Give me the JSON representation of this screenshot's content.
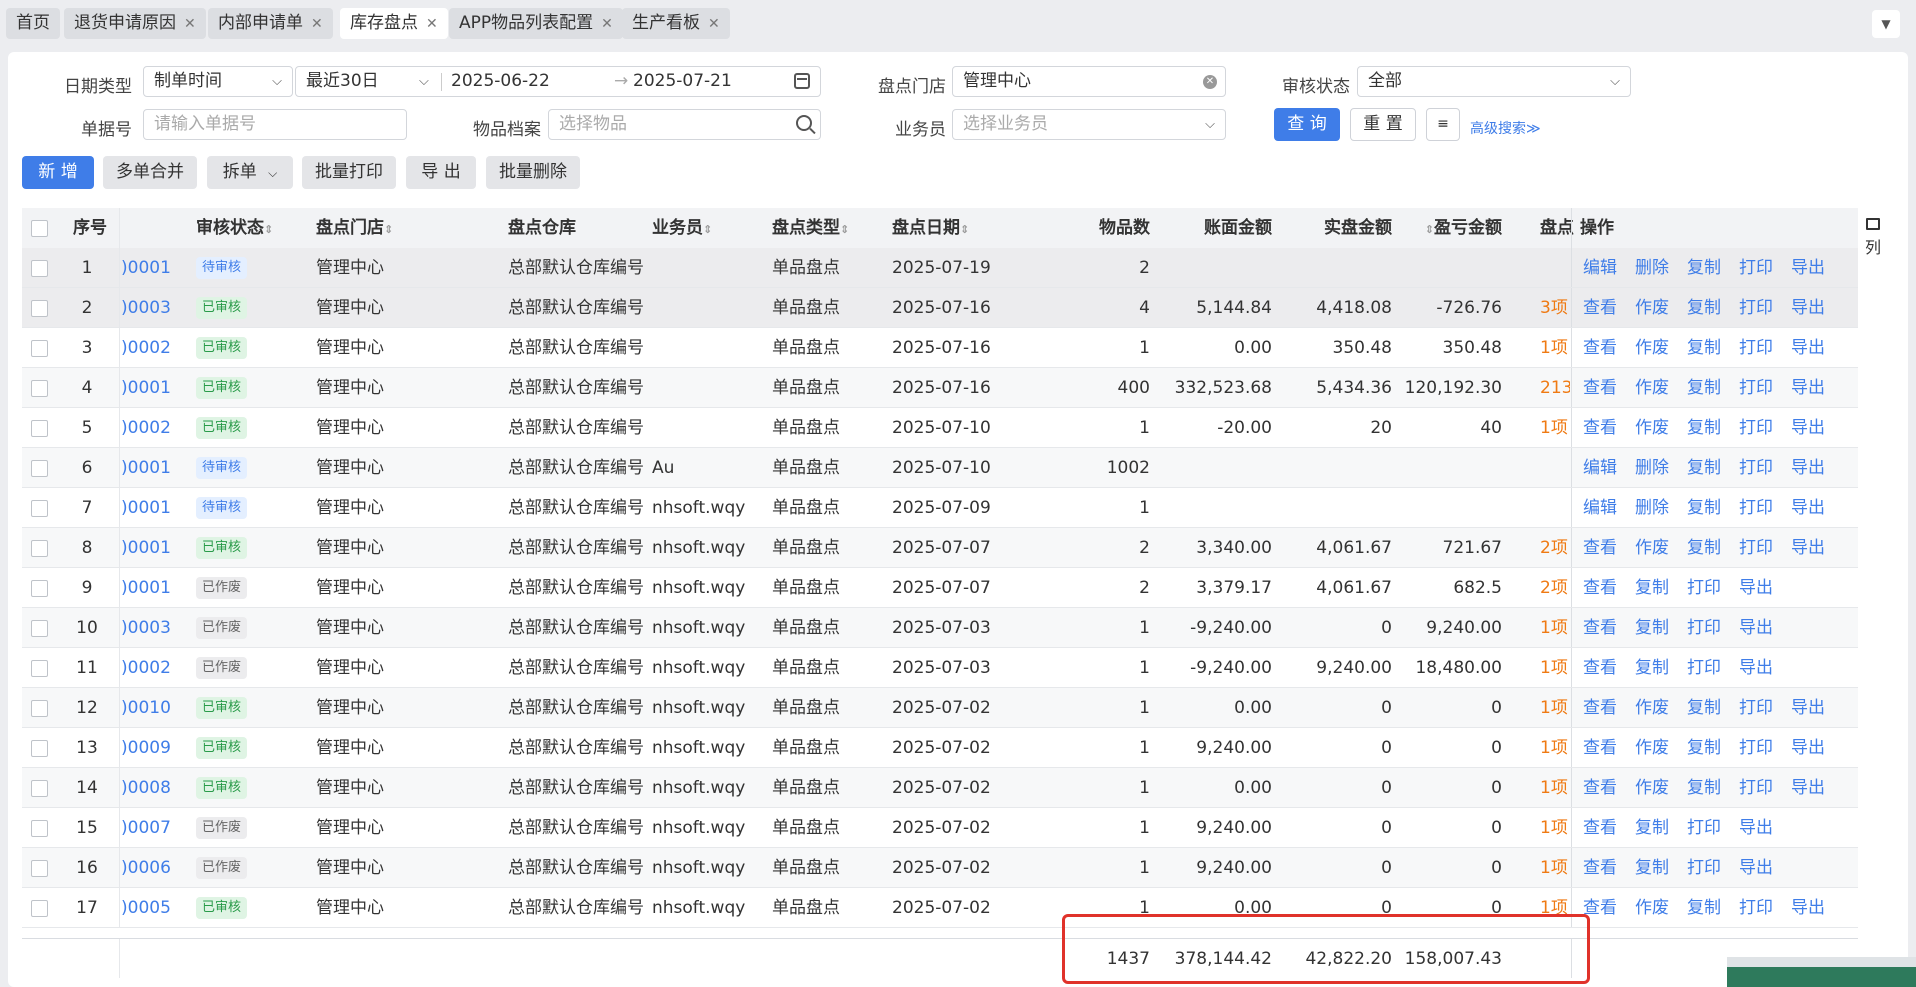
{
  "tabs": [
    {
      "label": "首页",
      "closable": false,
      "active": false
    },
    {
      "label": "退货申请原因",
      "closable": true,
      "active": false
    },
    {
      "label": "内部申请单",
      "closable": true,
      "active": false
    },
    {
      "label": "库存盘点",
      "closable": true,
      "active": true
    },
    {
      "label": "APP物品列表配置",
      "closable": true,
      "active": false
    },
    {
      "label": "生产看板",
      "closable": true,
      "active": false
    }
  ],
  "filters": {
    "date_type_label": "日期类型",
    "date_type_value": "制单时间",
    "date_range_preset": "最近30日",
    "date_start": "2025-06-22",
    "date_arrow": "→",
    "date_end": "2025-07-21",
    "store_label": "盘点门店",
    "store_value": "管理中心",
    "audit_label": "审核状态",
    "audit_value": "全部",
    "doc_no_label": "单据号",
    "doc_no_placeholder": "请输入单据号",
    "item_label": "物品档案",
    "item_placeholder": "选择物品",
    "salesman_label": "业务员",
    "salesman_placeholder": "选择业务员",
    "query": "查 询",
    "reset": "重 置",
    "advanced": "高级搜索≫"
  },
  "toolbar": {
    "add": "新 增",
    "merge": "多单合并",
    "split": "拆单",
    "batch_print": "批量打印",
    "export": "导 出",
    "batch_delete": "批量删除"
  },
  "columns": {
    "seq": "序号",
    "status": "审核状态",
    "store": "盘点门店",
    "warehouse": "盘点仓库",
    "salesman": "业务员",
    "type": "盘点类型",
    "date": "盘点日期",
    "count": "物品数",
    "book_amount": "账面金额",
    "actual_amount": "实盘金额",
    "diff_amount": "盈亏金额",
    "diff_cut": "盘点",
    "ops": "操作",
    "column_settings": "列"
  },
  "rows": [
    {
      "seq": "1",
      "code": ")0001",
      "status": "待审核",
      "st": "pend",
      "store": "管理中心",
      "warehouse": "总部默认仓库编号",
      "salesman": "",
      "type": "单品盘点",
      "date": "2025-07-19",
      "count": "2",
      "book": "",
      "actual": "",
      "diff": "",
      "diffnote": "",
      "ops": [
        "编辑",
        "删除",
        "复制",
        "打印",
        "导出"
      ]
    },
    {
      "seq": "2",
      "code": ")0003",
      "status": "已审核",
      "st": "ok",
      "store": "管理中心",
      "warehouse": "总部默认仓库编号",
      "salesman": "",
      "type": "单品盘点",
      "date": "2025-07-16",
      "count": "4",
      "book": "5,144.84",
      "actual": "4,418.08",
      "diff": "-726.76",
      "diffnote": "3项",
      "ops": [
        "查看",
        "作废",
        "复制",
        "打印",
        "导出"
      ]
    },
    {
      "seq": "3",
      "code": ")0002",
      "status": "已审核",
      "st": "ok",
      "store": "管理中心",
      "warehouse": "总部默认仓库编号",
      "salesman": "",
      "type": "单品盘点",
      "date": "2025-07-16",
      "count": "1",
      "book": "0.00",
      "actual": "350.48",
      "diff": "350.48",
      "diffnote": "1项",
      "ops": [
        "查看",
        "作废",
        "复制",
        "打印",
        "导出"
      ]
    },
    {
      "seq": "4",
      "code": ")0001",
      "status": "已审核",
      "st": "ok",
      "store": "管理中心",
      "warehouse": "总部默认仓库编号",
      "salesman": "",
      "type": "单品盘点",
      "date": "2025-07-16",
      "count": "400",
      "book": "332,523.68",
      "actual": "5,434.36",
      "diff": "120,192.30",
      "diffnote": "213",
      "ops": [
        "查看",
        "作废",
        "复制",
        "打印",
        "导出"
      ]
    },
    {
      "seq": "5",
      "code": ")0002",
      "status": "已审核",
      "st": "ok",
      "store": "管理中心",
      "warehouse": "总部默认仓库编号",
      "salesman": "",
      "type": "单品盘点",
      "date": "2025-07-10",
      "count": "1",
      "book": "-20.00",
      "actual": "20",
      "diff": "40",
      "diffnote": "1项",
      "ops": [
        "查看",
        "作废",
        "复制",
        "打印",
        "导出"
      ]
    },
    {
      "seq": "6",
      "code": ")0001",
      "status": "待审核",
      "st": "pend",
      "store": "管理中心",
      "warehouse": "总部默认仓库编号",
      "salesman": "Au",
      "type": "单品盘点",
      "date": "2025-07-10",
      "count": "1002",
      "book": "",
      "actual": "",
      "diff": "",
      "diffnote": "",
      "ops": [
        "编辑",
        "删除",
        "复制",
        "打印",
        "导出"
      ]
    },
    {
      "seq": "7",
      "code": ")0001",
      "status": "待审核",
      "st": "pend",
      "store": "管理中心",
      "warehouse": "总部默认仓库编号",
      "salesman": "nhsoft.wqy",
      "type": "单品盘点",
      "date": "2025-07-09",
      "count": "1",
      "book": "",
      "actual": "",
      "diff": "",
      "diffnote": "",
      "ops": [
        "编辑",
        "删除",
        "复制",
        "打印",
        "导出"
      ]
    },
    {
      "seq": "8",
      "code": ")0001",
      "status": "已审核",
      "st": "ok",
      "store": "管理中心",
      "warehouse": "总部默认仓库编号",
      "salesman": "nhsoft.wqy",
      "type": "单品盘点",
      "date": "2025-07-07",
      "count": "2",
      "book": "3,340.00",
      "actual": "4,061.67",
      "diff": "721.67",
      "diffnote": "2项",
      "ops": [
        "查看",
        "作废",
        "复制",
        "打印",
        "导出"
      ]
    },
    {
      "seq": "9",
      "code": ")0001",
      "status": "已作废",
      "st": "void",
      "store": "管理中心",
      "warehouse": "总部默认仓库编号",
      "salesman": "nhsoft.wqy",
      "type": "单品盘点",
      "date": "2025-07-07",
      "count": "2",
      "book": "3,379.17",
      "actual": "4,061.67",
      "diff": "682.5",
      "diffnote": "2项",
      "ops": [
        "查看",
        "复制",
        "打印",
        "导出"
      ]
    },
    {
      "seq": "10",
      "code": ")0003",
      "status": "已作废",
      "st": "void",
      "store": "管理中心",
      "warehouse": "总部默认仓库编号",
      "salesman": "nhsoft.wqy",
      "type": "单品盘点",
      "date": "2025-07-03",
      "count": "1",
      "book": "-9,240.00",
      "actual": "0",
      "diff": "9,240.00",
      "diffnote": "1项",
      "ops": [
        "查看",
        "复制",
        "打印",
        "导出"
      ]
    },
    {
      "seq": "11",
      "code": ")0002",
      "status": "已作废",
      "st": "void",
      "store": "管理中心",
      "warehouse": "总部默认仓库编号",
      "salesman": "nhsoft.wqy",
      "type": "单品盘点",
      "date": "2025-07-03",
      "count": "1",
      "book": "-9,240.00",
      "actual": "9,240.00",
      "diff": "18,480.00",
      "diffnote": "1项",
      "ops": [
        "查看",
        "复制",
        "打印",
        "导出"
      ]
    },
    {
      "seq": "12",
      "code": ")0010",
      "status": "已审核",
      "st": "ok",
      "store": "管理中心",
      "warehouse": "总部默认仓库编号",
      "salesman": "nhsoft.wqy",
      "type": "单品盘点",
      "date": "2025-07-02",
      "count": "1",
      "book": "0.00",
      "actual": "0",
      "diff": "0",
      "diffnote": "1项",
      "ops": [
        "查看",
        "作废",
        "复制",
        "打印",
        "导出"
      ]
    },
    {
      "seq": "13",
      "code": ")0009",
      "status": "已审核",
      "st": "ok",
      "store": "管理中心",
      "warehouse": "总部默认仓库编号",
      "salesman": "nhsoft.wqy",
      "type": "单品盘点",
      "date": "2025-07-02",
      "count": "1",
      "book": "9,240.00",
      "actual": "0",
      "diff": "0",
      "diffnote": "1项",
      "ops": [
        "查看",
        "作废",
        "复制",
        "打印",
        "导出"
      ]
    },
    {
      "seq": "14",
      "code": ")0008",
      "status": "已审核",
      "st": "ok",
      "store": "管理中心",
      "warehouse": "总部默认仓库编号",
      "salesman": "nhsoft.wqy",
      "type": "单品盘点",
      "date": "2025-07-02",
      "count": "1",
      "book": "0.00",
      "actual": "0",
      "diff": "0",
      "diffnote": "1项",
      "ops": [
        "查看",
        "作废",
        "复制",
        "打印",
        "导出"
      ]
    },
    {
      "seq": "15",
      "code": ")0007",
      "status": "已作废",
      "st": "void",
      "store": "管理中心",
      "warehouse": "总部默认仓库编号",
      "salesman": "nhsoft.wqy",
      "type": "单品盘点",
      "date": "2025-07-02",
      "count": "1",
      "book": "9,240.00",
      "actual": "0",
      "diff": "0",
      "diffnote": "1项",
      "ops": [
        "查看",
        "复制",
        "打印",
        "导出"
      ]
    },
    {
      "seq": "16",
      "code": ")0006",
      "status": "已作废",
      "st": "void",
      "store": "管理中心",
      "warehouse": "总部默认仓库编号",
      "salesman": "nhsoft.wqy",
      "type": "单品盘点",
      "date": "2025-07-02",
      "count": "1",
      "book": "9,240.00",
      "actual": "0",
      "diff": "0",
      "diffnote": "1项",
      "ops": [
        "查看",
        "复制",
        "打印",
        "导出"
      ]
    },
    {
      "seq": "17",
      "code": ")0005",
      "status": "已审核",
      "st": "ok",
      "store": "管理中心",
      "warehouse": "总部默认仓库编号",
      "salesman": "nhsoft.wqy",
      "type": "单品盘点",
      "date": "2025-07-02",
      "count": "1",
      "book": "0.00",
      "actual": "0",
      "diff": "0",
      "diffnote": "1项",
      "ops": [
        "查看",
        "作废",
        "复制",
        "打印",
        "导出"
      ]
    }
  ],
  "totals": {
    "count": "1437",
    "book": "378,144.42",
    "actual": "42,822.20",
    "diff": "158,007.43"
  }
}
